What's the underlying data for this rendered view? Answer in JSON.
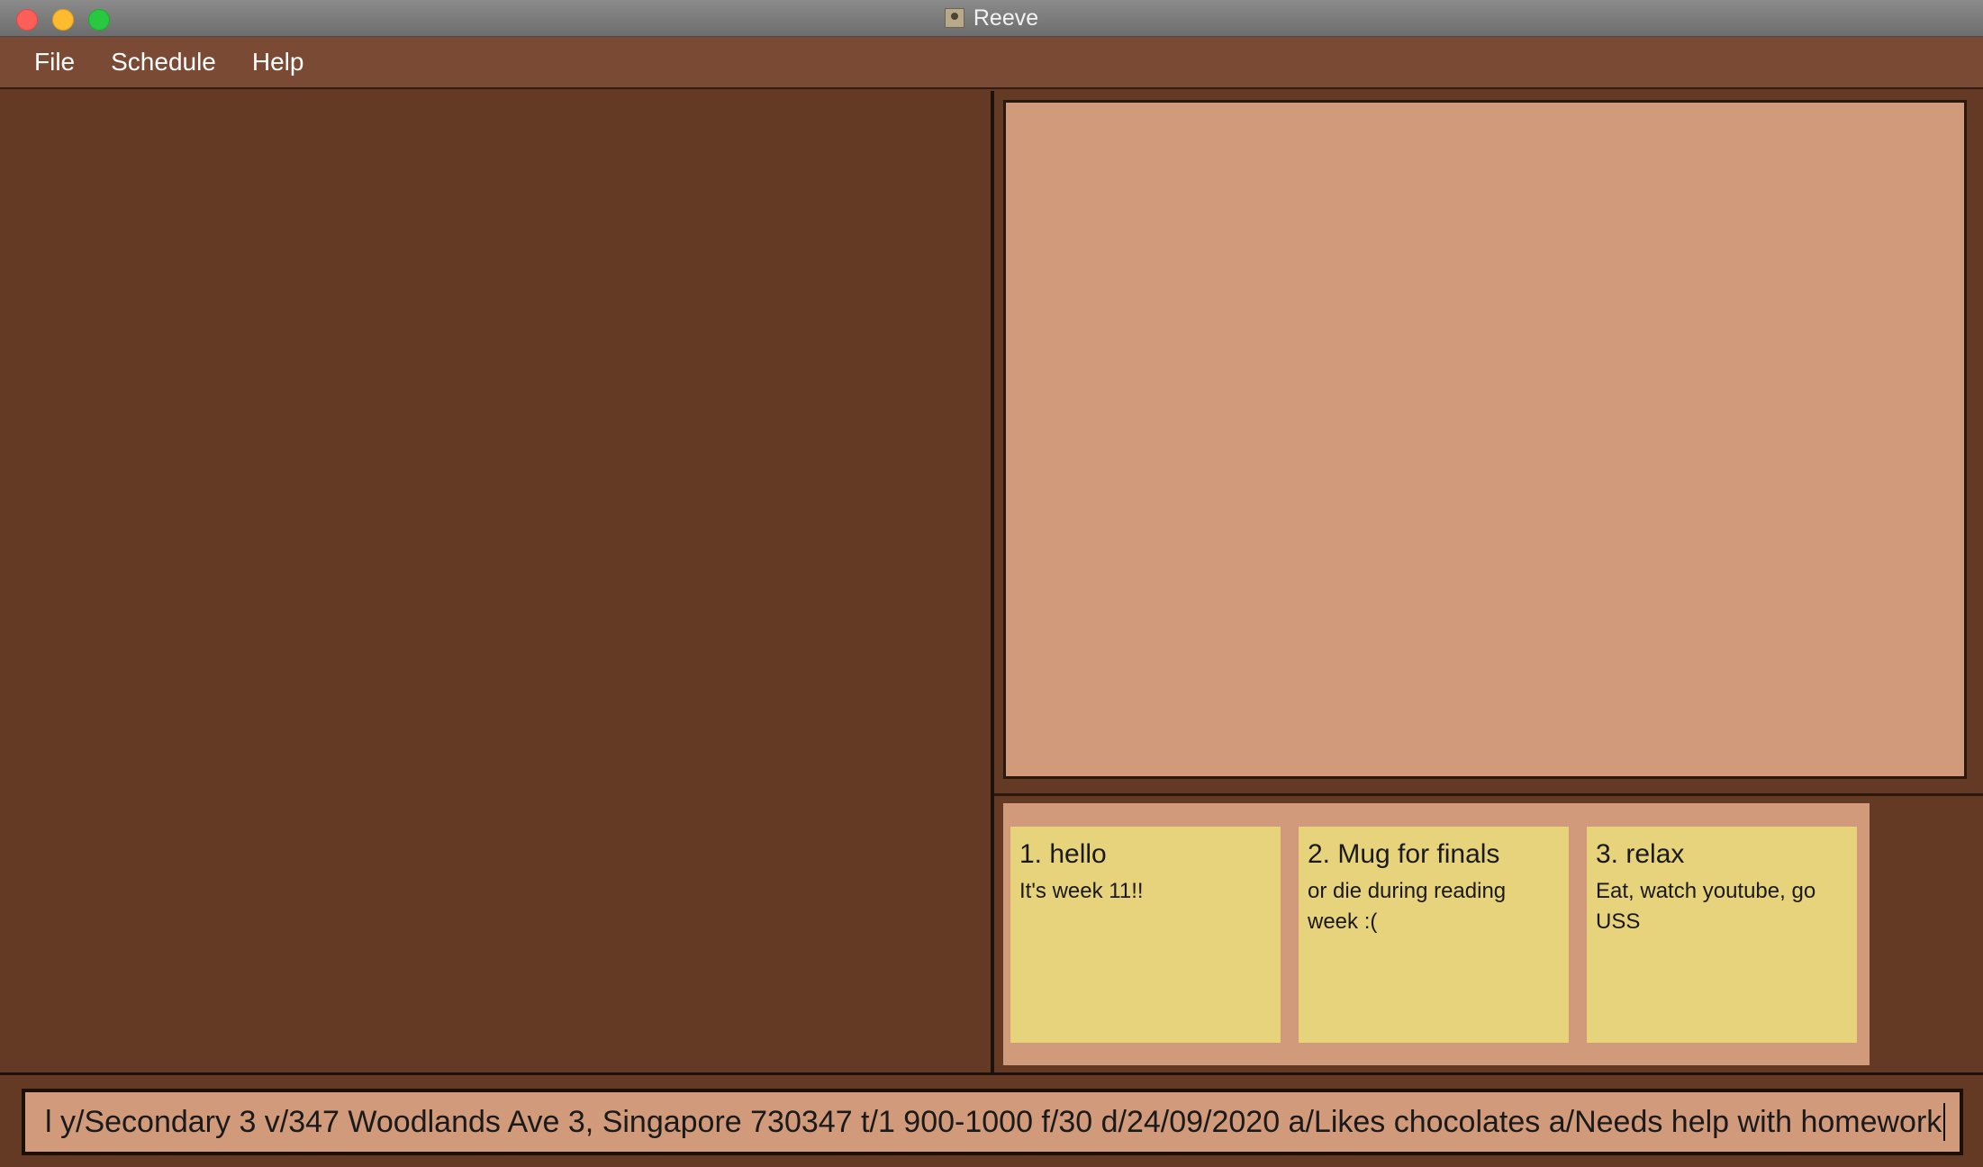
{
  "window": {
    "title": "Reeve"
  },
  "menu": {
    "items": [
      "File",
      "Schedule",
      "Help"
    ]
  },
  "notes": [
    {
      "title": "1. hello",
      "body": "It's week 11!!"
    },
    {
      "title": "2. Mug for finals",
      "body": "or die during reading week :("
    },
    {
      "title": "3. relax",
      "body": "Eat, watch youtube, go USS"
    }
  ],
  "command": {
    "value": "l y/Secondary 3 v/347 Woodlands Ave 3, Singapore 730347 t/1 900-1000 f/30 d/24/09/2020 a/Likes chocolates a/Needs help with homework"
  },
  "colors": {
    "background": "#643a25",
    "menubar": "#7a4a34",
    "panel": "#d19a7b",
    "note": "#e7d37b"
  }
}
